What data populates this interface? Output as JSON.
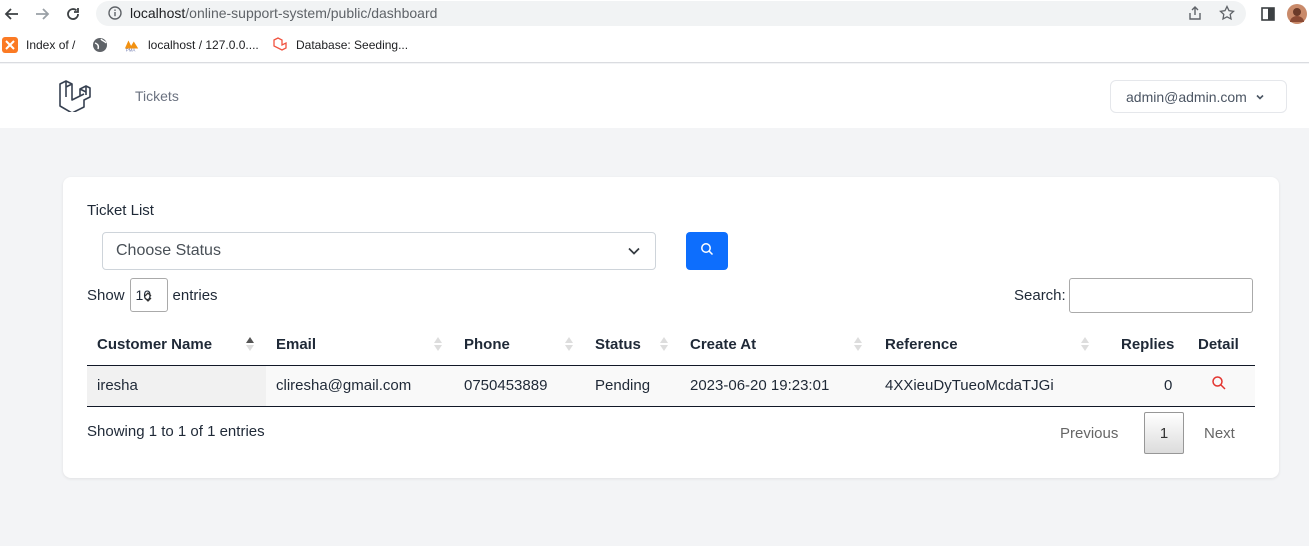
{
  "browser": {
    "url_host": "localhost",
    "url_path": "/online-support-system/public/dashboard",
    "bookmarks": [
      {
        "label": "Index of /",
        "icon": "xampp-icon"
      },
      {
        "label": "",
        "icon": "globe-icon"
      },
      {
        "label": "localhost / 127.0.0....",
        "icon": "phpmyadmin-icon"
      },
      {
        "label": "Database: Seeding...",
        "icon": "laravel-icon"
      }
    ]
  },
  "nav": {
    "tickets_label": "Tickets",
    "user_email": "admin@admin.com"
  },
  "card": {
    "title": "Ticket List",
    "status_placeholder": "Choose Status",
    "show_label": "Show",
    "page_length": "10",
    "entries_label": "entries",
    "search_label": "Search:"
  },
  "table": {
    "columns": [
      "Customer Name",
      "Email",
      "Phone",
      "Status",
      "Create At",
      "Reference",
      "Replies",
      "Detail"
    ],
    "rows": [
      {
        "customer_name": "iresha",
        "email": "cliresha@gmail.com",
        "phone": "0750453889",
        "status": "Pending",
        "created_at": "2023-06-20 19:23:01",
        "reference": "4XXieuDyTueoMcdaTJGi",
        "replies": "0"
      }
    ]
  },
  "footer": {
    "info": "Showing 1 to 1 of 1 entries",
    "previous_label": "Previous",
    "current_page": "1",
    "next_label": "Next"
  },
  "colors": {
    "primary": "#0d6efd",
    "detail_icon": "#e3342f",
    "page_bg": "#f3f4f6"
  }
}
